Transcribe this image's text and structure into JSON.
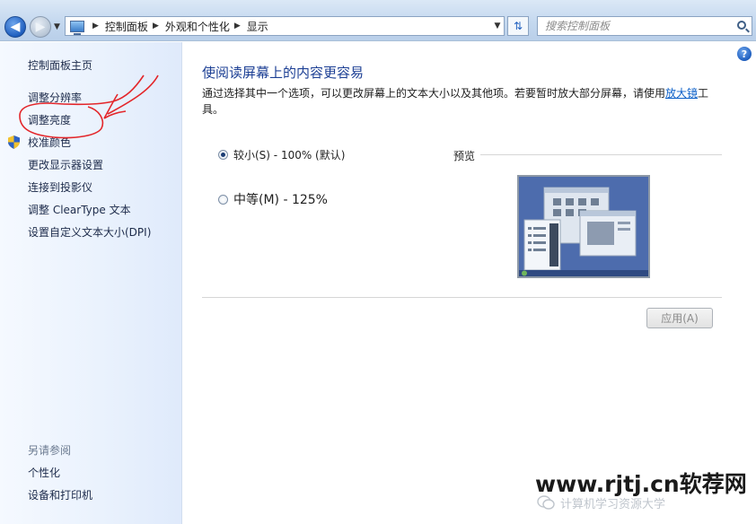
{
  "address_bar": {
    "breadcrumbs": [
      "控制面板",
      "外观和个性化",
      "显示"
    ],
    "search_placeholder": "搜索控制面板"
  },
  "left_pane": {
    "home_link": "控制面板主页",
    "links": [
      "调整分辨率",
      "调整亮度",
      "校准颜色",
      "更改显示器设置",
      "连接到投影仪",
      "调整 ClearType 文本",
      "设置自定义文本大小(DPI)"
    ],
    "see_also_title": "另请参阅",
    "see_also_links": [
      "个性化",
      "设备和打印机"
    ]
  },
  "main": {
    "title": "使阅读屏幕上的内容更容易",
    "description_prefix": "通过选择其中一个选项，可以更改屏幕上的文本大小以及其他项。若要暂时放大部分屏幕，请使用",
    "description_link": "放大镜",
    "description_suffix": "工具。",
    "options": [
      {
        "label": "较小(S) - 100% (默认)",
        "checked": true
      },
      {
        "label": "中等(M) - 125%",
        "checked": false
      }
    ],
    "preview_label": "预览",
    "apply_button": "应用(A)"
  },
  "watermark": {
    "main": "www.rjtj.cn软荐网",
    "sub": "计算机学习资源大学"
  },
  "colors": {
    "title_blue": "#1c3f94",
    "link_blue": "#0b5fc8",
    "annotation_red": "#e3262a"
  }
}
